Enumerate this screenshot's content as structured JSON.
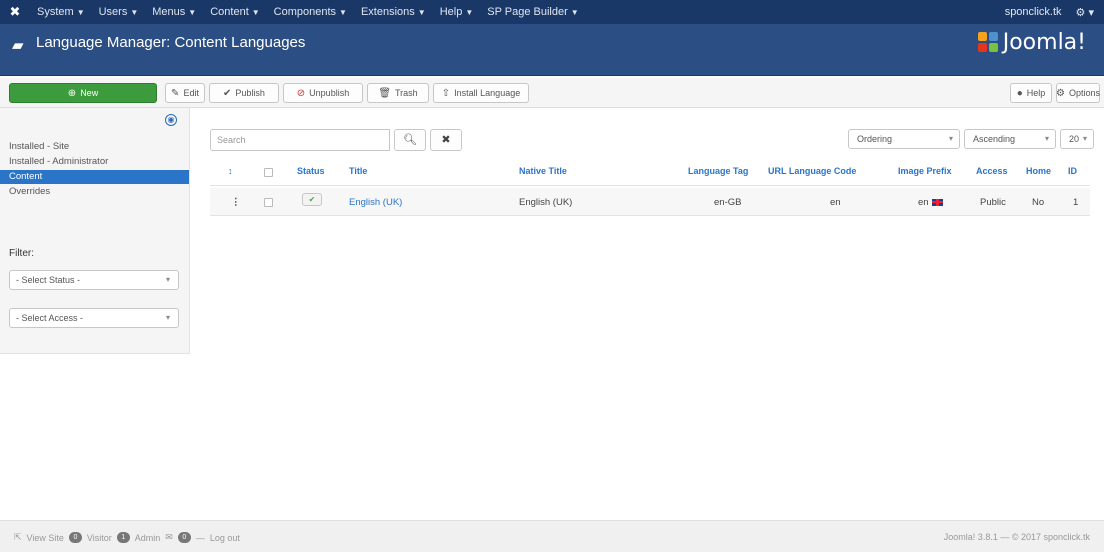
{
  "topnav": {
    "logo_icon": "joomla-icon",
    "menus": [
      {
        "label": "System"
      },
      {
        "label": "Users"
      },
      {
        "label": "Menus"
      },
      {
        "label": "Content"
      },
      {
        "label": "Components"
      },
      {
        "label": "Extensions"
      },
      {
        "label": "Help"
      },
      {
        "label": "SP Page Builder"
      }
    ],
    "site_name": "sponclick.tk",
    "user_icon": "gear-icon"
  },
  "header": {
    "title": "Language Manager: Content Languages",
    "icon": "comments-icon",
    "brand": "Joomla!"
  },
  "toolbar": {
    "new": "New",
    "edit": "Edit",
    "publish": "Publish",
    "unpublish": "Unpublish",
    "trash": "Trash",
    "install": "Install Language",
    "help": "Help",
    "options": "Options"
  },
  "sidebar": {
    "items": [
      {
        "label": "Installed - Site",
        "active": false
      },
      {
        "label": "Installed - Administrator",
        "active": false
      },
      {
        "label": "Content",
        "active": true
      },
      {
        "label": "Overrides",
        "active": false
      }
    ],
    "filter_label": "Filter:",
    "status_select": "- Select Status -",
    "access_select": "- Select Access -"
  },
  "search": {
    "placeholder": "Search"
  },
  "sorting": {
    "ordering": "Ordering",
    "direction": "Ascending",
    "limit": "20"
  },
  "table": {
    "headers": {
      "ordering": "↕",
      "status": "Status",
      "title": "Title",
      "native_title": "Native Title",
      "language_tag": "Language Tag",
      "url_code": "URL Language Code",
      "image_prefix": "Image Prefix",
      "access": "Access",
      "home": "Home",
      "id": "ID"
    },
    "rows": [
      {
        "title": "English (UK)",
        "native_title": "English (UK)",
        "language_tag": "en-GB",
        "url_code": "en",
        "image_prefix": "en",
        "access": "Public",
        "home": "No",
        "id": "1",
        "published": true
      }
    ]
  },
  "footer": {
    "view_site": "View Site",
    "visitors": "0",
    "visitors_label": "Visitor",
    "admin": "1",
    "admin_label": "Admin",
    "messages": "0",
    "logout": "Log out",
    "version": "Joomla! 3.8.1 — © 2017 sponclick.tk"
  },
  "colors": {
    "topnav": "#1a3867",
    "header": "#2b4f84",
    "accent": "#2a75c8",
    "new_button": "#3c9b3c"
  }
}
